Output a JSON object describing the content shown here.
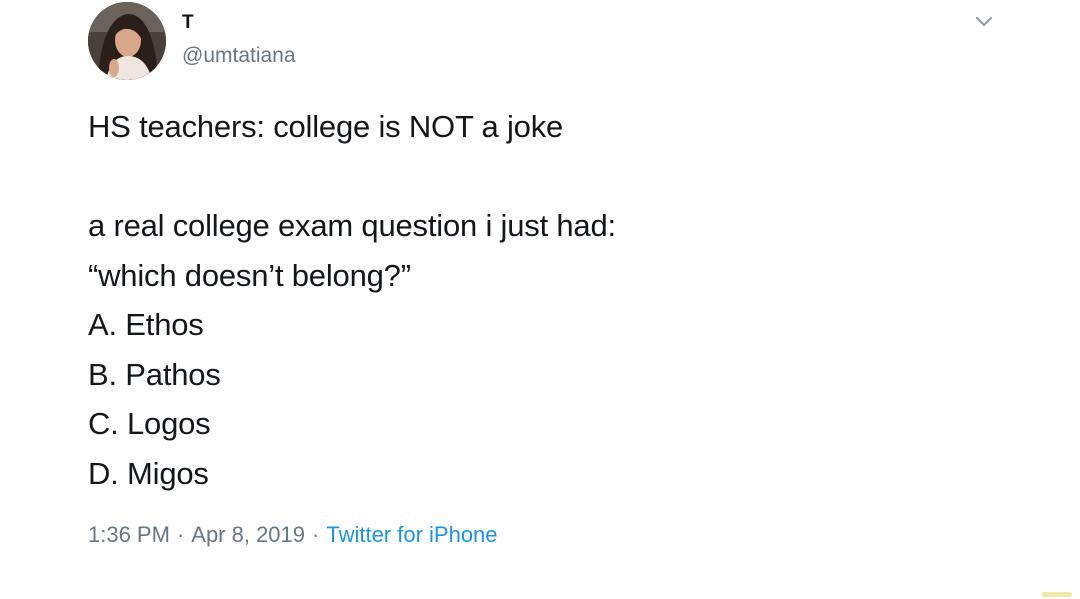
{
  "user": {
    "display_name": "T",
    "handle": "@umtatiana",
    "avatar_icon": "profile-photo"
  },
  "menu": {
    "icon": "chevron-down-icon"
  },
  "tweet": {
    "lines": [
      "HS teachers: college is NOT a joke",
      "",
      "a real college exam question i just had:",
      "“which doesn’t belong?”",
      "A. Ethos",
      "B. Pathos",
      "C. Logos",
      "D. Migos"
    ]
  },
  "meta": {
    "time": "1:36 PM",
    "separator": "·",
    "date": "Apr 8, 2019",
    "source": "Twitter for iPhone"
  },
  "colors": {
    "text": "#14171a",
    "secondary": "#657786",
    "link": "#1b95e0"
  }
}
